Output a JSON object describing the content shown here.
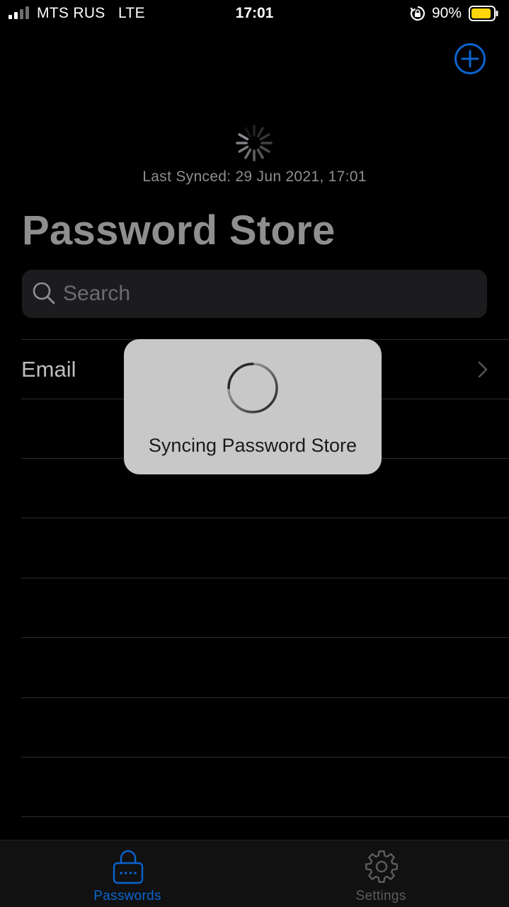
{
  "status_bar": {
    "carrier": "MTS RUS",
    "network": "LTE",
    "time": "17:01",
    "battery_percent": "90%",
    "battery_level": 0.9,
    "battery_color": "#ffd60a",
    "icons": [
      "signal-icon",
      "rotation-lock-icon",
      "battery-icon"
    ]
  },
  "header": {
    "add_icon": "plus-circle-icon",
    "accent": "#0a64d0"
  },
  "sync": {
    "last_synced": "Last Synced: 29 Jun 2021, 17:01"
  },
  "title": "Password Store",
  "search": {
    "placeholder": "Search",
    "value": ""
  },
  "list": {
    "items": [
      {
        "label": "Email"
      }
    ]
  },
  "hud": {
    "message": "Syncing Password Store"
  },
  "tab_bar": {
    "tabs": [
      {
        "label": "Passwords",
        "icon": "lock-icon",
        "active": true
      },
      {
        "label": "Settings",
        "icon": "gear-icon",
        "active": false
      }
    ],
    "active_color": "#0a64d0",
    "inactive_color": "#5c5c5c"
  }
}
